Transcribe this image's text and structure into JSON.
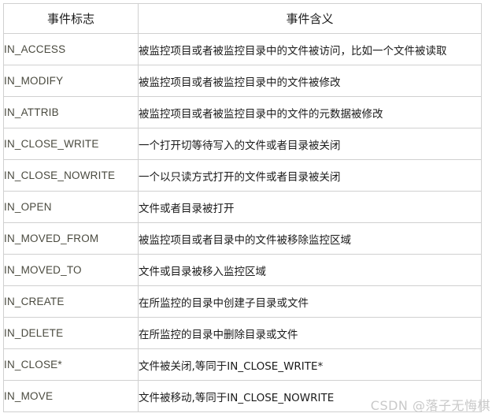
{
  "table": {
    "columns": [
      {
        "header": "事件标志"
      },
      {
        "header": "事件含义"
      }
    ],
    "rows": [
      {
        "flag": "IN_ACCESS",
        "meaning": "被监控项目或者被监控目录中的文件被访问，比如一个文件被读取"
      },
      {
        "flag": "IN_MODIFY",
        "meaning": "被监控项目或者被监控目录中的文件被修改"
      },
      {
        "flag": "IN_ATTRIB",
        "meaning": "被监控项目或者被监控目录中的文件的元数据被修改"
      },
      {
        "flag": "IN_CLOSE_WRITE",
        "meaning": "一个打开切等待写入的文件或者目录被关闭"
      },
      {
        "flag": "IN_CLOSE_NOWRITE",
        "meaning": "一个以只读方式打开的文件或者目录被关闭"
      },
      {
        "flag": "IN_OPEN",
        "meaning": "文件或者目录被打开"
      },
      {
        "flag": "IN_MOVED_FROM",
        "meaning": "被监控项目或者目录中的文件被移除监控区域"
      },
      {
        "flag": "IN_MOVED_TO",
        "meaning": "文件或目录被移入监控区域"
      },
      {
        "flag": "IN_CREATE",
        "meaning": "在所监控的目录中创建子目录或文件"
      },
      {
        "flag": "IN_DELETE",
        "meaning": "在所监控的目录中删除目录或文件"
      },
      {
        "flag": "IN_CLOSE*",
        "meaning": "文件被关闭,等同于IN_CLOSE_WRITE*"
      },
      {
        "flag": "IN_MOVE",
        "meaning": "文件被移动,等同于IN_CLOSE_NOWRITE"
      }
    ]
  },
  "watermark": {
    "text": "CSDN @落子无悔棋"
  },
  "colors": {
    "border": "#d0d0d0",
    "flag_text": "#4a4a3f",
    "meaning_text": "#1a1a1a",
    "watermark": "#c9c9c9"
  }
}
